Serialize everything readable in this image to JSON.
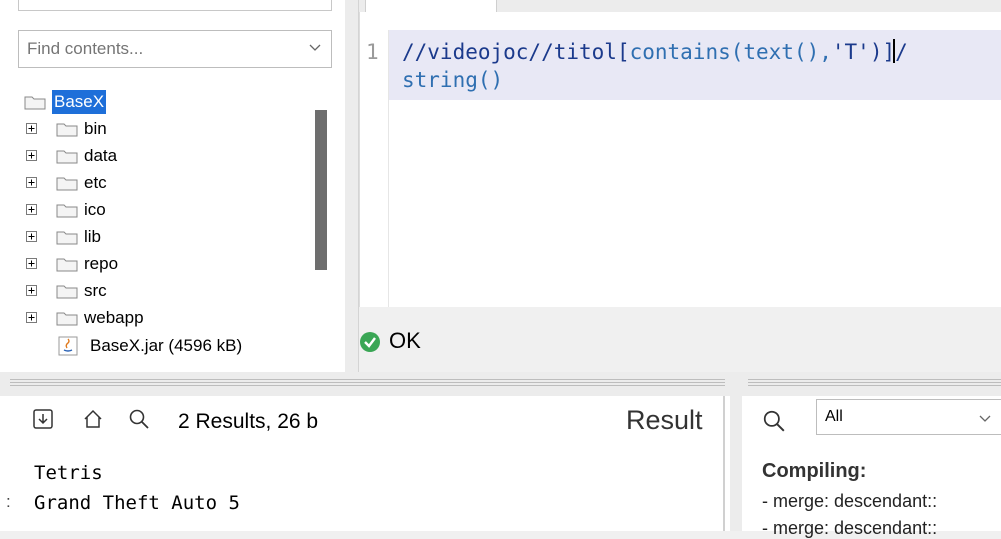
{
  "project": {
    "filter_placeholder": "Find contents...",
    "root": "BaseX",
    "folders": [
      "bin",
      "data",
      "etc",
      "ico",
      "lib",
      "repo",
      "src",
      "webapp"
    ],
    "file": "BaseX.jar (4596 kB)"
  },
  "editor": {
    "line_number": "1",
    "code": {
      "path1": "//videojoc//titol",
      "bracket_open": "[",
      "fn": "contains(text(),",
      "str": "'T'",
      "close": ")]",
      "slash": "/",
      "fn2": "string()"
    }
  },
  "status": {
    "text": "OK",
    "color": "#3aa655"
  },
  "result": {
    "count": "2 Results, 26 b",
    "title": "Result",
    "lines": [
      "Tetris",
      "Grand Theft Auto 5"
    ],
    "marker": ":"
  },
  "info": {
    "filter_value": "All",
    "heading": "Compiling:",
    "lines": [
      "- merge: descendant::",
      "- merge: descendant::"
    ]
  },
  "colors": {
    "selection": "#1e6fd9",
    "line_highlight": "#e8e8f5"
  }
}
